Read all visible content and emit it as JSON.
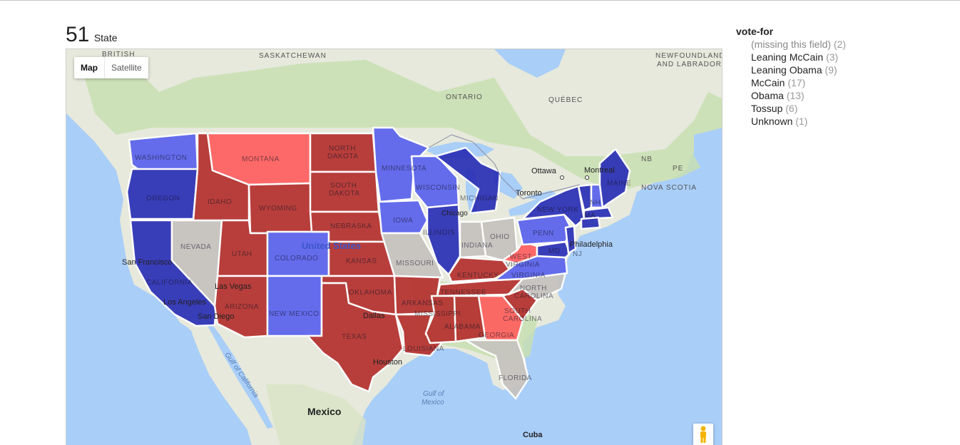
{
  "header": {
    "count": "51",
    "label": "State"
  },
  "map_controls": {
    "map_label": "Map",
    "satellite_label": "Satellite"
  },
  "colors": {
    "water": "#a9cef8",
    "land": "#e6e9dc",
    "green": "#c8dfb2",
    "obama": "#2a2fb6",
    "leaning_obama": "#5a62ee",
    "mccain": "#b5302e",
    "leaning_mccain": "#ff5f5f",
    "tossup": "#c6c3bf",
    "border": "#ffffff"
  },
  "facet": {
    "title": "vote-for",
    "items": [
      {
        "label": "(missing this field)",
        "count": "(2)"
      },
      {
        "label": "Leaning McCain",
        "count": "(3)"
      },
      {
        "label": "Leaning Obama",
        "count": "(9)"
      },
      {
        "label": "McCain",
        "count": "(17)"
      },
      {
        "label": "Obama",
        "count": "(13)"
      },
      {
        "label": "Tossup",
        "count": "(6)"
      },
      {
        "label": "Unknown",
        "count": "(1)"
      }
    ]
  },
  "map_labels": {
    "british_columbia": "BRITISH\nCOLUMBIA",
    "saskatchewan": "SASKATCHEWAN",
    "newfoundland": "NEWFOUNDLAND\nAND LABRADOR",
    "ontario": "ONTARIO",
    "quebec": "QUÉBEC",
    "nb": "NB",
    "pe": "PE",
    "nova_scotia": "NOVA SCOTIA",
    "ottawa": "Ottawa",
    "montreal": "Montreal",
    "toronto": "Toronto",
    "chicago": "Chicago",
    "philadelphia": "Philadelphia",
    "san_francisco": "San Francisco",
    "los_angeles": "Los Angeles",
    "san_diego": "San Diego",
    "las_vegas": "Las Vegas",
    "dallas": "Dallas",
    "houston": "Houston",
    "united_states": "United States",
    "mexico": "Mexico",
    "cuba": "Cuba",
    "gulf_of_mexico": "Gulf of\nMexico",
    "gulf_of_california": "Gulf of California",
    "washington": "WASHINGTON",
    "oregon": "OREGON",
    "california": "CALIFORNIA",
    "nevada": "NEVADA",
    "idaho": "IDAHO",
    "montana": "MONTANA",
    "wyoming": "WYOMING",
    "utah": "UTAH",
    "arizona": "ARIZONA",
    "colorado": "COLORADO",
    "new_mexico": "NEW MEXICO",
    "north_dakota": "NORTH\nDAKOTA",
    "south_dakota": "SOUTH\nDAKOTA",
    "nebraska": "NEBRASKA",
    "kansas": "KANSAS",
    "oklahoma": "OKLAHOMA",
    "texas": "TEXAS",
    "minnesota": "MINNESOTA",
    "iowa": "IOWA",
    "missouri": "MISSOURI",
    "arkansas": "ARKANSAS",
    "louisiana": "LOUISIANA",
    "wisconsin": "WISCONSIN",
    "michigan": "MICHIGAN",
    "illinois": "ILLINOIS",
    "indiana": "INDIANA",
    "ohio": "OHIO",
    "kentucky": "KENTUCKY",
    "tennessee": "TENNESSEE",
    "mississippi": "MISSISSIPPI",
    "alabama": "ALABAMA",
    "georgia": "GEORGIA",
    "florida": "FLORIDA",
    "south_carolina": "SOUTH\nCAROLINA",
    "north_carolina": "NORTH\nCAROLINA",
    "virginia": "VIRGINIA",
    "west_virginia": "WEST\nVIRGINIA",
    "penn": "PENN",
    "new_york": "NEW YORK",
    "maine": "MAINE",
    "md": "MD",
    "nj": "NJ",
    "nh": "NH",
    "ma": "MA"
  }
}
